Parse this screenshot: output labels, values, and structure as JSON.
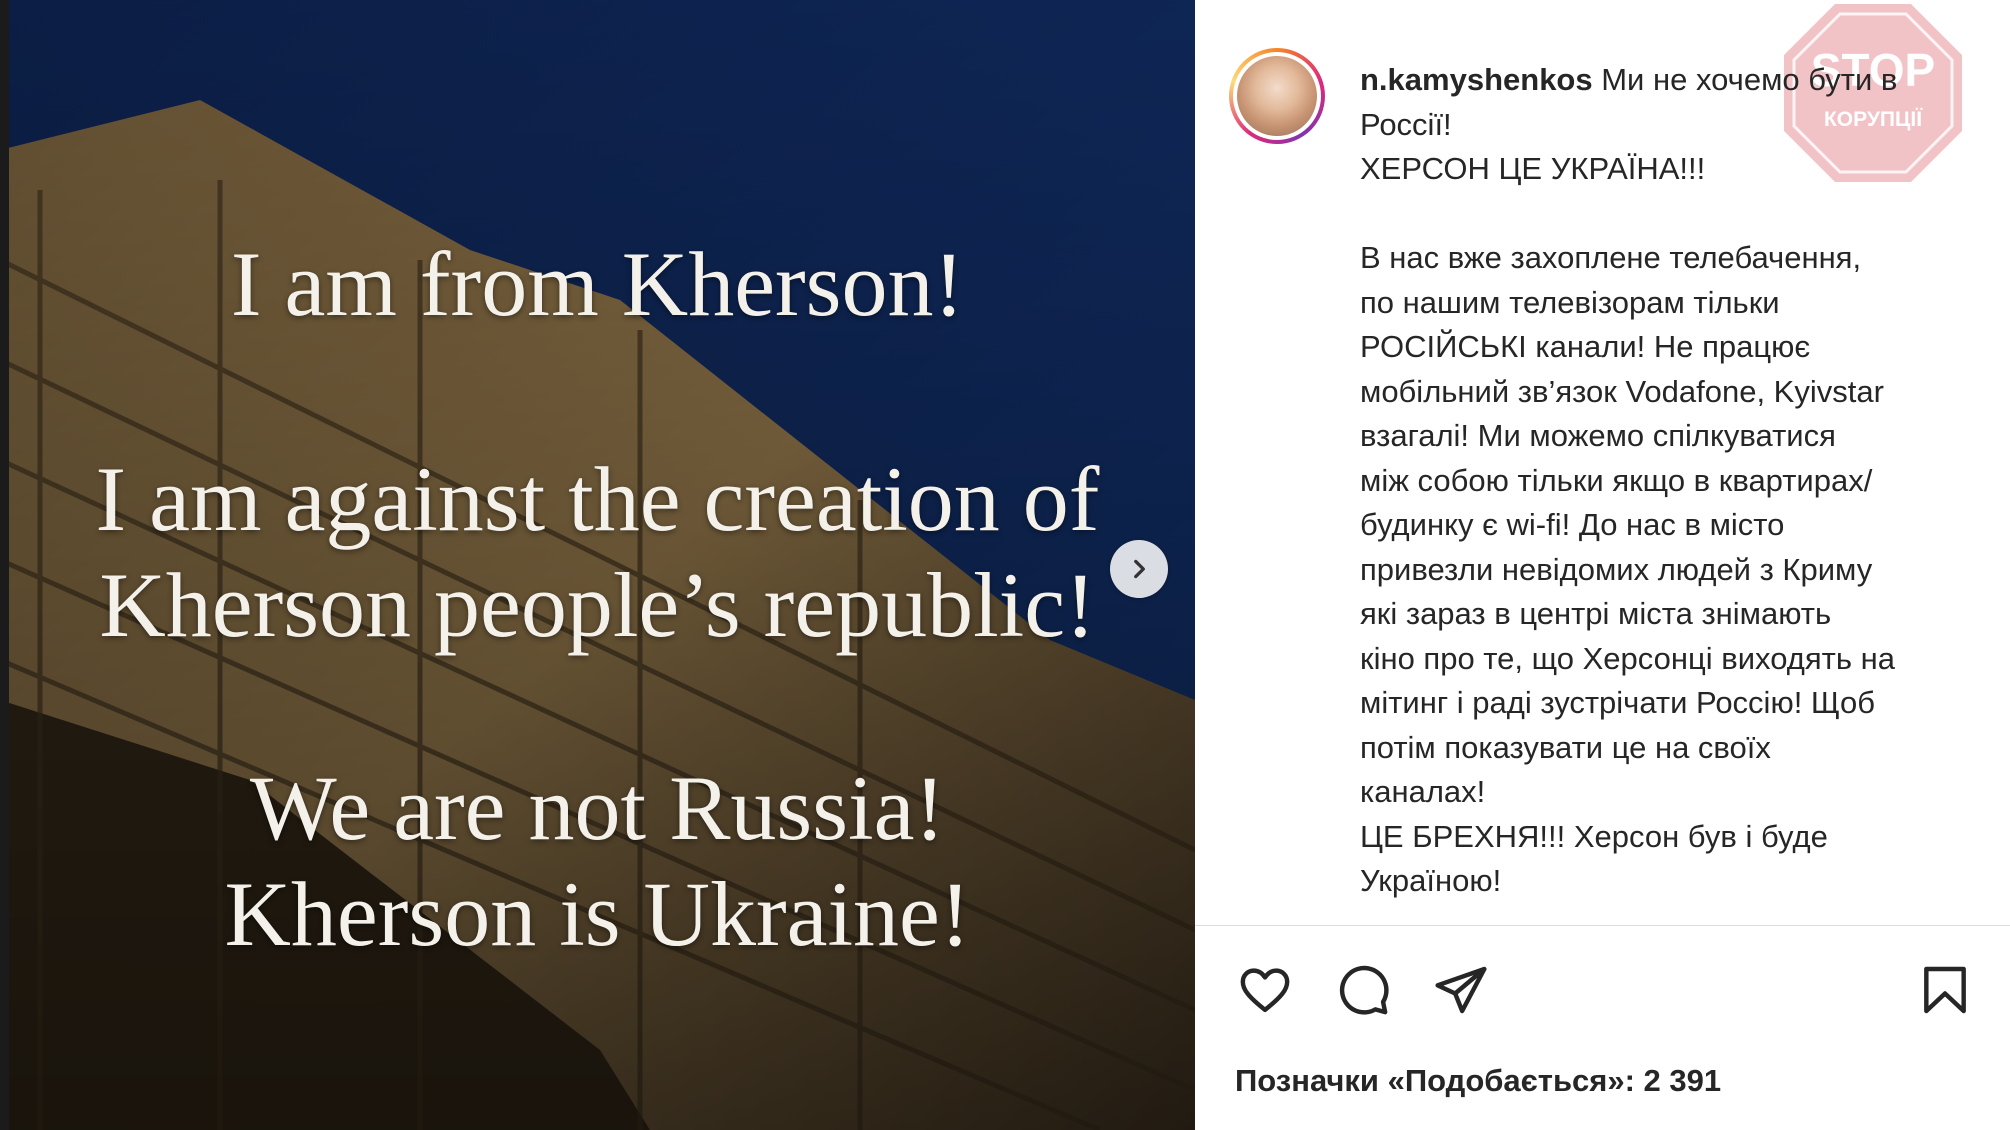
{
  "image": {
    "lines": [
      "I am from Kherson!",
      "I am against the creation of",
      "Kherson people’s republic!",
      "We are not Russia!",
      "Kherson is Ukraine!"
    ],
    "next_icon": "chevron-right-icon"
  },
  "post": {
    "username": "n.kamyshenkos",
    "caption_first": "Ми не хочемо бути в",
    "caption_lines": [
      "Россії!",
      "ХЕРСОН ЦЕ УКРАЇНА!!!",
      "",
      "В нас вже захоплене телебачення,",
      "по нашим телевізорам тільки",
      "РОСІЙСЬКІ канали! Не працює",
      "мобільний зв’язок Vodafone, Kyivstar",
      "взагалі! Ми можемо спілкуватися",
      "між собою тільки якщо в квартирах/",
      "будинку є wi-fi! До нас в місто",
      "привезли невідомих людей з Криму",
      "які зараз в центрі міста знімають",
      "кіно про те, що Херсонці виходять на",
      "мітинг і раді зустрічати Россію! Щоб",
      "потім показувати це на своїх",
      "каналах!",
      "ЦЕ БРЕХНЯ!!! Херсон був і буде",
      "Україною!"
    ],
    "watermark": {
      "top": "STOP",
      "bottom": "КОРУПЦІЇ"
    },
    "actions": [
      "heart-icon",
      "comment-icon",
      "share-icon",
      "bookmark-icon"
    ],
    "likes": "Позначки «Подобається»: 2 391"
  },
  "colors": {
    "image_sky": "#0e2350",
    "building": "#a5895a",
    "watermark": "#e9a3a9"
  }
}
